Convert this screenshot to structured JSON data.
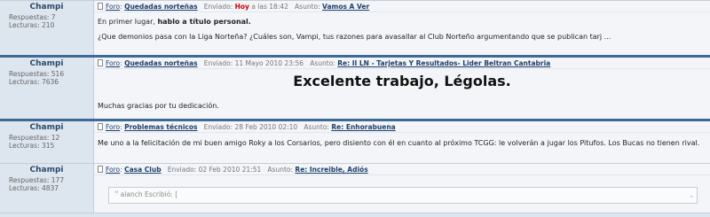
{
  "posts": [
    {
      "user": "Champi",
      "respuestas": "Respuestas: 7",
      "lecturas": "Lecturas: 210",
      "foro_label": "Foro",
      "foro": "Quedadas norteñas",
      "enviado_label": "Enviado:",
      "enviado_hoy": "Hoy",
      "enviado_rest": "a las 18:42",
      "asunto_label": "Asunto:",
      "asunto": "Vamos A Ver",
      "line1_a": "En primer lugar, ",
      "line1_b": "hablo a título personal.",
      "line2": "¿Que demonios pasa con la Liga Norteña? ¿Cuáles son, Vampi, tus razones para avasallar al Club Norteño argumentando que se publican tarj ..."
    },
    {
      "user": "Champi",
      "respuestas": "Respuestas: 516",
      "lecturas": "Lecturas: 7636",
      "foro_label": "Foro",
      "foro": "Quedadas norteñas",
      "enviado": "Enviado: 11 Mayo 2010 23:56",
      "asunto_label": "Asunto:",
      "asunto": "Re: II LN - Tarjetas Y Resultados- Lider Beltran Cantabria",
      "headline": "Excelente trabajo, Légolas.",
      "line": "Muchas gracias por tu dedicación."
    },
    {
      "user": "Champi",
      "respuestas": "Respuestas: 12",
      "lecturas": "Lecturas: 315",
      "foro_label": "Foro",
      "foro": "Problemas técnicos",
      "enviado": "Enviado: 28 Feb 2010 02:10",
      "asunto_label": "Asunto:",
      "asunto": "Re: Enhorabuena",
      "text": "Me uno a la felicitación de mi buen amigo Roky a los Corsarios, pero disiento con él en cuanto al próximo TCGG: le volverán a jugar los Pitufos. Los Bucas no tienen rival."
    },
    {
      "user": "Champi",
      "respuestas": "Respuestas: 177",
      "lecturas": "Lecturas: 4837",
      "foro_label": "Foro",
      "foro": "Casa Club",
      "enviado": "Enviado: 02 Feb 2010 21:51",
      "asunto_label": "Asunto:",
      "asunto": "Re: Increible, Adiós",
      "quote_mark": "“",
      "quote": "alanch Escribió: [",
      "quote_end": "”"
    }
  ]
}
